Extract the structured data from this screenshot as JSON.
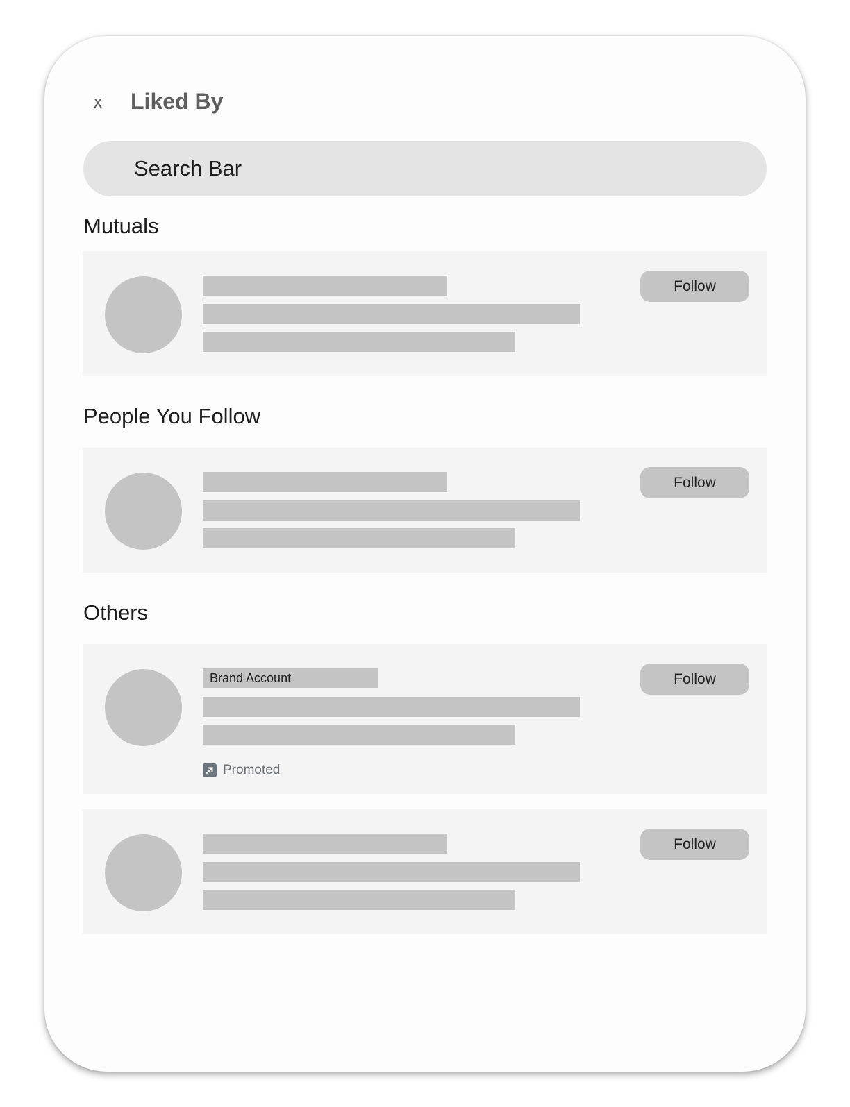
{
  "header": {
    "close_label": "x",
    "title": "Liked By"
  },
  "search": {
    "placeholder": "Search Bar"
  },
  "sections": [
    {
      "title": "Mutuals",
      "items": [
        {
          "follow_label": "Follow"
        }
      ]
    },
    {
      "title": "People You Follow",
      "items": [
        {
          "follow_label": "Follow"
        }
      ]
    },
    {
      "title": "Others",
      "items": [
        {
          "badge": "Brand Account",
          "follow_label": "Follow",
          "promoted_label": "Promoted",
          "promoted_icon": "arrow-up-right-icon"
        },
        {
          "follow_label": "Follow"
        }
      ]
    }
  ],
  "colors": {
    "placeholder_gray": "#c4c4c4",
    "row_background": "#f4f4f4",
    "search_background": "#e4e4e4",
    "title_gray": "#5f5f5f"
  }
}
